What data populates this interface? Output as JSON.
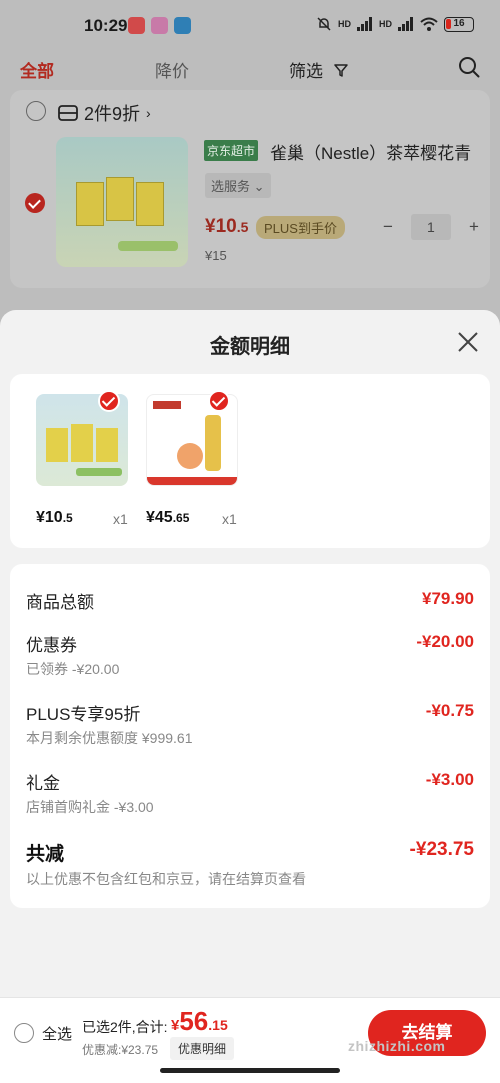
{
  "status_bar": {
    "time": "10:29",
    "hd1": "HD",
    "hd2": "HD",
    "battery": "16"
  },
  "tabs": {
    "all": "全部",
    "price_drop": "降价",
    "filter": "筛选"
  },
  "cart_item": {
    "promo": "2件9折",
    "store_tag": "京东超市",
    "name": "雀巢（Nestle）茶萃樱花青",
    "service": "选服务",
    "price_int": "¥10",
    "price_dec": ".5",
    "plus_tag": "PLUS到手价",
    "quantity": "1",
    "original_price": "¥15",
    "minus": "−",
    "plus": "+"
  },
  "sheet": {
    "title": "金额明细",
    "items": [
      {
        "price_int": "¥10",
        "price_dec": ".5",
        "qty": "x1"
      },
      {
        "price_int": "¥45",
        "price_dec": ".65",
        "qty": "x1"
      }
    ],
    "rows": {
      "goods_total_label": "商品总额",
      "goods_total_value": "¥79.90",
      "coupon_label": "优惠券",
      "coupon_value": "-¥20.00",
      "coupon_sub": "已领券 -¥20.00",
      "plus_label": "PLUS专享95折",
      "plus_value": "-¥0.75",
      "plus_sub": "本月剩余优惠额度 ¥999.61",
      "gift_label": "礼金",
      "gift_value": "-¥3.00",
      "gift_sub": "店铺首购礼金 -¥3.00",
      "total_label": "共减",
      "total_value": "-¥23.75",
      "total_sub": "以上优惠不包含红包和京豆，请在结算页查看"
    }
  },
  "bottom_bar": {
    "select_all": "全选",
    "selected_info": "已选2件,合计:",
    "total_sym": "¥",
    "total_int": "56",
    "total_dec": ".15",
    "discount": "优惠减:¥23.75",
    "detail_button": "优惠明细",
    "checkout": "去结算"
  },
  "watermark": "zhizhizhi.com",
  "colors": {
    "accent_red": "#e0251f",
    "dim_red": "#b22a20",
    "store_green": "#3a7d4a"
  }
}
